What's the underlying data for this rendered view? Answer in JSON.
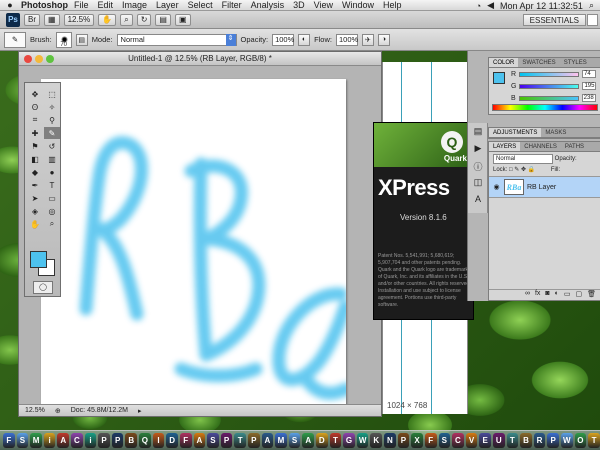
{
  "menubar": {
    "app_name": "Photoshop",
    "menus": [
      "File",
      "Edit",
      "Image",
      "Layer",
      "Select",
      "Filter",
      "Analysis",
      "3D",
      "View",
      "Window",
      "Help"
    ],
    "clock": "Mon Apr 12  11:32:51"
  },
  "appbar": {
    "logo": "Ps",
    "zoom": "12.5%",
    "workspace": "ESSENTIALS"
  },
  "options": {
    "brush_label": "Brush:",
    "brush_size": "70",
    "mode_label": "Mode:",
    "mode_value": "Normal",
    "opacity_label": "Opacity:",
    "opacity_value": "100%",
    "flow_label": "Flow:",
    "flow_value": "100%"
  },
  "document": {
    "title": "Untitled-1 @ 12.5% (RB Layer, RGB/8) *",
    "zoom_status": "12.5%",
    "doc_size": "Doc: 45.8M/12.2M",
    "strokes_text": "RBa",
    "stroke_color": "#5ec8f0"
  },
  "tools": {
    "foreground_color": "#4dc2ee",
    "background_color": "#ffffff"
  },
  "quark": {
    "brand_word": "XPress",
    "logo_word": "Quark",
    "version": "Version 8.1.6",
    "legal": "Patent Nos. 5,541,991; 5,680,619; 5,907,704 and other patents pending. Quark and the Quark logo are trademarks of Quark, Inc. and its affiliates in the U.S. and/or other countries. All rights reserved. Installation and use subject to license agreement. Portions use third-party software."
  },
  "bg_window": {
    "size_text": "1024 × 768"
  },
  "panels": {
    "color_tabs": [
      "COLOR",
      "SWATCHES",
      "STYLES"
    ],
    "color_labels": [
      "R",
      "G",
      "B"
    ],
    "color_values": [
      "74",
      "195",
      "238"
    ],
    "adjust_tabs": [
      "ADJUSTMENTS",
      "MASKS"
    ],
    "layer_tabs": [
      "LAYERS",
      "CHANNELS",
      "PATHS"
    ],
    "blend_mode": "Normal",
    "opacity_label": "Opacity:",
    "lock_label": "Lock:",
    "fill_label": "Fill:",
    "layer_name": "RB Layer",
    "layer_thumb": "RBa"
  },
  "dock": {
    "icons": [
      "Fi",
      "Sa",
      "Ma",
      "iC",
      "Ad",
      "Ca",
      "iT",
      "Ph",
      "Ps",
      "Br",
      "Qx",
      "Id",
      "Dw",
      "Fl",
      "Ai",
      "Sy",
      "Pr",
      "Te",
      "Pv",
      "Ac",
      "Mo",
      "Sk",
      "Ap",
      "Do",
      "Tr",
      "Ga",
      "Wo",
      "Ke",
      "Nu",
      "Pa",
      "Xc",
      "Fo",
      "Sc",
      "Ca",
      "Vi",
      "Ex",
      "Ut",
      "Tv",
      "Bo",
      "Re",
      "Pd",
      "Wd",
      "Ok",
      "Tr2"
    ]
  }
}
